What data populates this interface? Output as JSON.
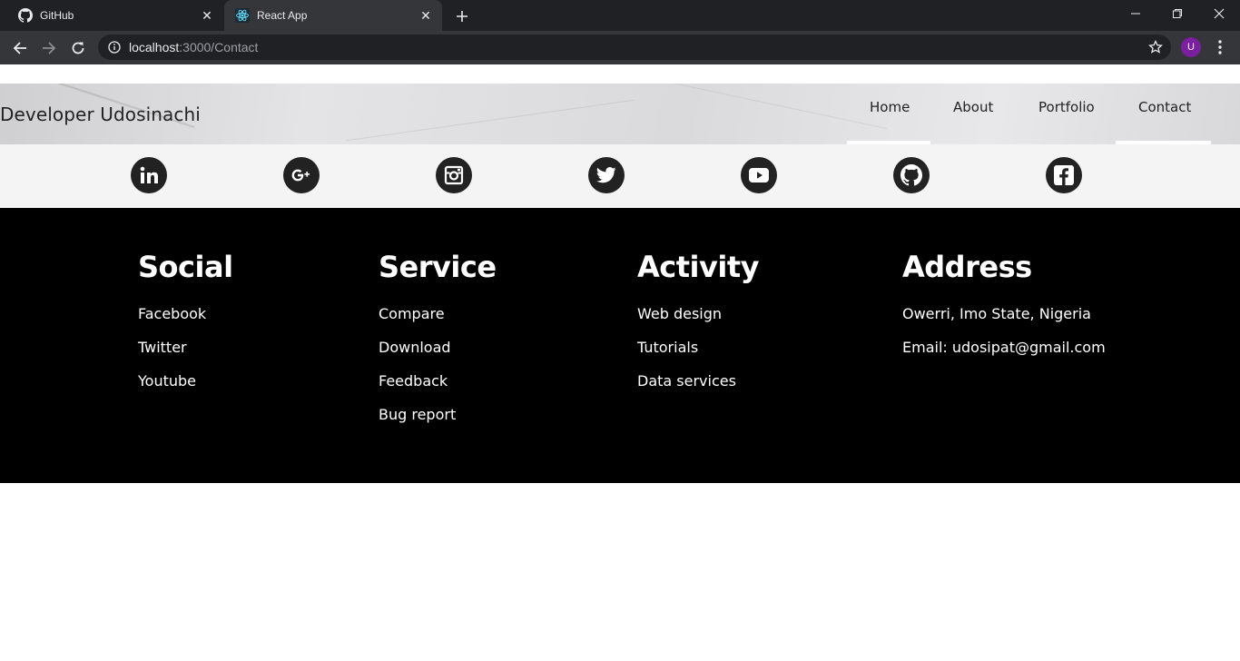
{
  "browser": {
    "tabs": [
      {
        "title": "GitHub",
        "favicon": "github-icon",
        "active": false
      },
      {
        "title": "React App",
        "favicon": "react-icon",
        "active": true
      }
    ],
    "url_host": "localhost",
    "url_rest": ":3000/Contact",
    "profile_initial": "U"
  },
  "header": {
    "brand": "Developer Udosinachi",
    "nav": [
      "Home",
      "About",
      "Portfolio",
      "Contact"
    ],
    "underlined": [
      "Home",
      "Contact"
    ]
  },
  "social_icons": [
    "linkedin-icon",
    "google-plus-icon",
    "instagram-icon",
    "twitter-icon",
    "youtube-icon",
    "github-icon",
    "facebook-icon"
  ],
  "footer": {
    "social": {
      "heading": "Social",
      "items": [
        "Facebook",
        "Twitter",
        "Youtube"
      ]
    },
    "service": {
      "heading": "Service",
      "items": [
        "Compare",
        "Download",
        "Feedback",
        "Bug report"
      ]
    },
    "activity": {
      "heading": "Activity",
      "items": [
        "Web design",
        "Tutorials",
        "Data services"
      ]
    },
    "address": {
      "heading": "Address",
      "items": [
        "Owerri, Imo State, Nigeria",
        "Email: udosipat@gmail.com"
      ]
    }
  },
  "colors": {
    "tabbar": "#202124",
    "toolbar": "#35363a",
    "footer_bg": "#000000",
    "social_bar": "#f4f4f4",
    "icon_circle": "#222222",
    "avatar": "#7b1fa2"
  }
}
